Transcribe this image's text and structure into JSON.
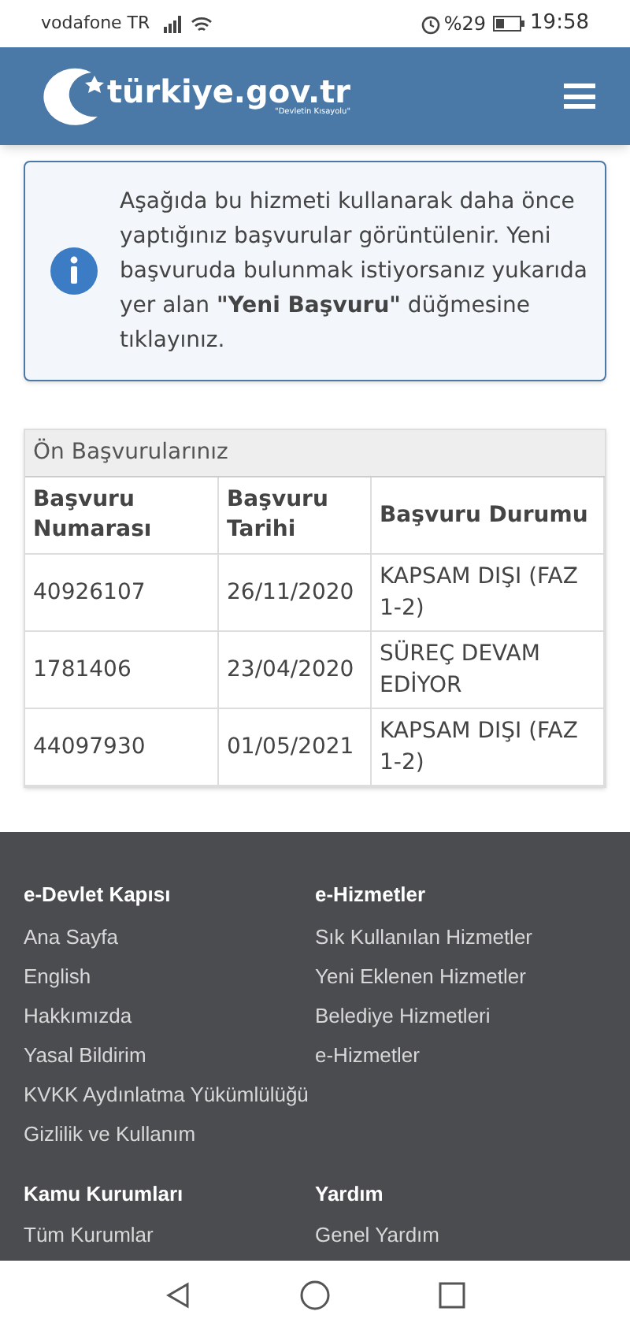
{
  "status_bar": {
    "carrier": "vodafone TR",
    "battery": "%29",
    "time": "19:58"
  },
  "header": {
    "logo": "türkiye.gov.tr",
    "tagline": "\"Devletin Kısayolu\""
  },
  "info": {
    "text": "Aşağıda bu hizmeti kullanarak daha önce yaptığınız başvurular görüntülenir. Yeni başvuruda bulunmak istiyorsanız yukarıda yer alan **\"Yeni Başvuru\"** düğmesine tıklayınız."
  },
  "table": {
    "title": "Ön Başvurularınız",
    "columns": [
      "Başvuru Numarası",
      "Başvuru Tarihi",
      "Başvuru Durumu"
    ],
    "rows": [
      [
        "40926107",
        "26/11/2020",
        "KAPSAM DIŞI (FAZ 1-2)"
      ],
      [
        "1781406",
        "23/04/2020",
        "SÜREÇ DEVAM EDİYOR"
      ],
      [
        "44097930",
        "01/05/2021",
        "KAPSAM DIŞI (FAZ 1-2)"
      ]
    ]
  },
  "footer": {
    "sections": [
      {
        "title": "e-Devlet Kapısı",
        "links": [
          "Ana Sayfa",
          "English",
          "Hakkımızda",
          "Yasal Bildirim",
          "KVKK Aydınlatma Yükümlülüğü",
          "Gizlilik ve Kullanım"
        ]
      },
      {
        "title": "e-Hizmetler",
        "links": [
          "Sık Kullanılan Hizmetler",
          "Yeni Eklenen Hizmetler",
          "Belediye Hizmetleri",
          "e-Hizmetler"
        ]
      },
      {
        "title": "Kamu Kurumları",
        "links": [
          "Tüm Kurumlar"
        ]
      },
      {
        "title": "Yardım",
        "links": [
          "Genel Yardım"
        ]
      }
    ]
  }
}
